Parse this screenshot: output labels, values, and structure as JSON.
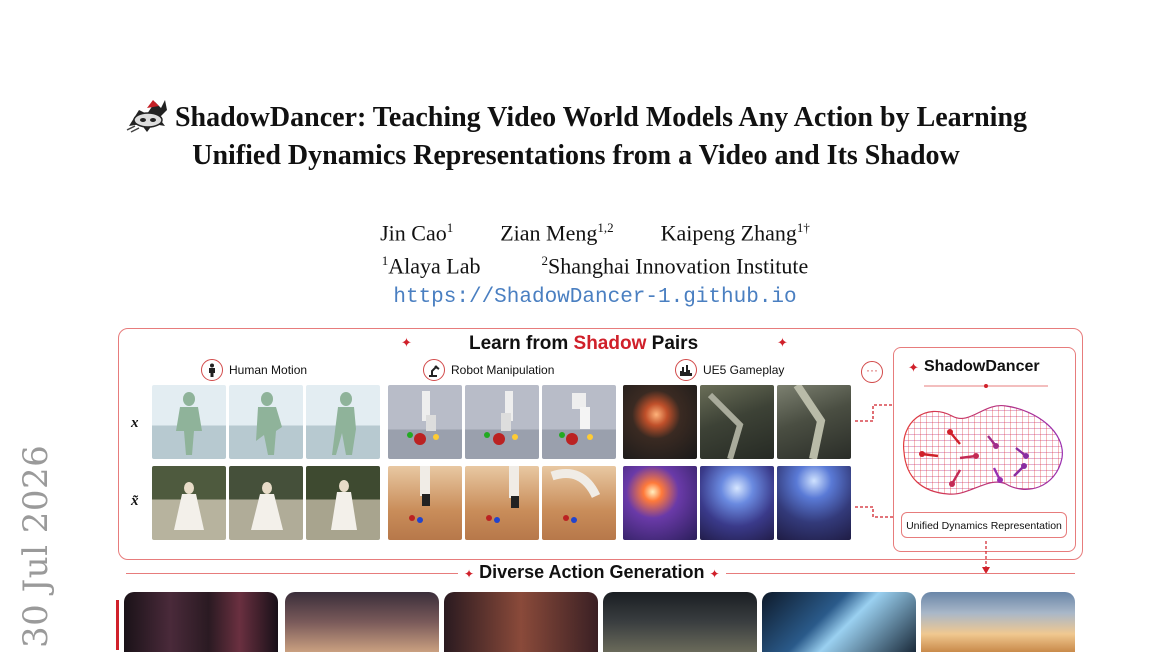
{
  "side_date": "30 Jul 2026",
  "title": {
    "line1": "ShadowDancer: Teaching Video World Models Any Action by Learning",
    "line2": "Unified Dynamics Representations from a Video and Its Shadow"
  },
  "authors": [
    {
      "name": "Jin Cao",
      "sup": "1"
    },
    {
      "name": "Zian Meng",
      "sup": "1,2"
    },
    {
      "name": "Kaipeng Zhang",
      "sup": "1†"
    }
  ],
  "affiliations": [
    {
      "sup": "1",
      "name": "Alaya Lab"
    },
    {
      "sup": "2",
      "name": "Shanghai Innovation Institute"
    }
  ],
  "url": "https://ShadowDancer-1.github.io",
  "figure": {
    "learn_title_prefix": "Learn from ",
    "learn_title_red": "Shadow",
    "learn_title_suffix": " Pairs",
    "categories": [
      "Human Motion",
      "Robot Manipulation",
      "UE5 Gameplay"
    ],
    "row_labels": [
      "x",
      "x̃"
    ],
    "model_name": "ShadowDancer",
    "representation_label": "Unified Dynamics Representation",
    "generation_title": "Diverse Action Generation",
    "accent_color": "#d0202a"
  }
}
